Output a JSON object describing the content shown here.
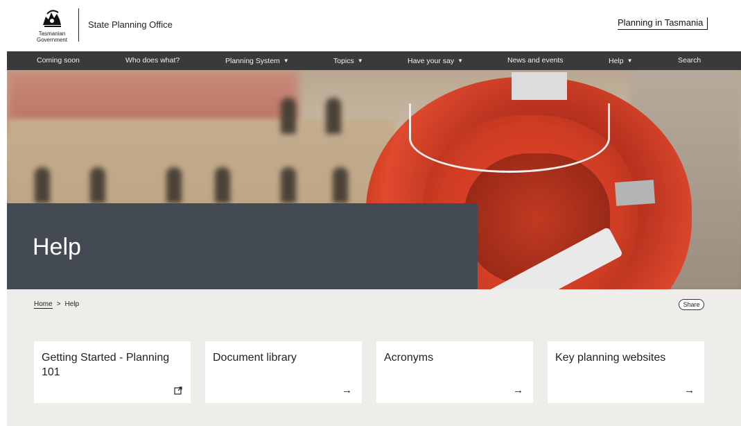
{
  "header": {
    "logo_text": "Tasmanian Government",
    "office_name": "State Planning Office",
    "planning_link": "Planning in Tasmania"
  },
  "nav": {
    "items": [
      {
        "label": "Coming soon",
        "has_dropdown": false
      },
      {
        "label": "Who does what?",
        "has_dropdown": false
      },
      {
        "label": "Planning System",
        "has_dropdown": true
      },
      {
        "label": "Topics",
        "has_dropdown": true
      },
      {
        "label": "Have your say",
        "has_dropdown": true
      },
      {
        "label": "News and events",
        "has_dropdown": false
      },
      {
        "label": "Help",
        "has_dropdown": true
      },
      {
        "label": "Search",
        "has_dropdown": false
      }
    ],
    "chevron": "⌄"
  },
  "hero": {
    "title": "Help"
  },
  "breadcrumb": {
    "home": "Home",
    "separator": ">",
    "current": "Help"
  },
  "share_label": "Share",
  "cards": [
    {
      "title": "Getting Started - Planning 101",
      "icon": "external-link-icon"
    },
    {
      "title": "Document library",
      "icon": "arrow-right-icon",
      "arrow": "→"
    },
    {
      "title": "Acronyms",
      "icon": "arrow-right-icon",
      "arrow": "→"
    },
    {
      "title": "Key planning websites",
      "icon": "arrow-right-icon",
      "arrow": "→"
    }
  ],
  "colors": {
    "nav_bg": "#3a3a3a",
    "hero_panel": "#444a53",
    "content_bg": "#efede9"
  }
}
